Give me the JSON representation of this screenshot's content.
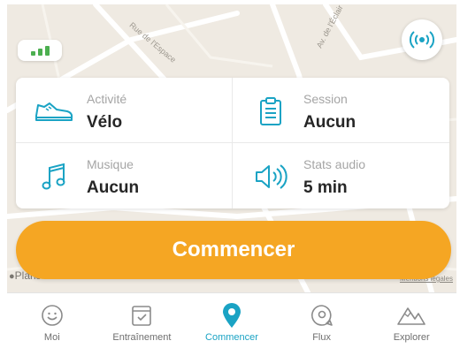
{
  "colors": {
    "accent": "#1aa3c4",
    "start_button": "#f5a623",
    "signal": "#4caf50",
    "map_background": "#efeae2"
  },
  "map": {
    "street_labels": [
      "Rue de l'Espace",
      "Av. de l'Éclair"
    ],
    "attribution": "Plans",
    "legal": "Mentions légales",
    "gps_signal_bars": 3,
    "broadcast_icon": "live-broadcast-icon"
  },
  "settings": {
    "activity": {
      "label": "Activité",
      "value": "Vélo",
      "icon": "shoe-icon"
    },
    "session": {
      "label": "Session",
      "value": "Aucun",
      "icon": "clipboard-icon"
    },
    "music": {
      "label": "Musique",
      "value": "Aucun",
      "icon": "music-note-icon"
    },
    "audio_stats": {
      "label": "Stats audio",
      "value": "5 min",
      "icon": "speaker-icon"
    }
  },
  "start_button": {
    "label": "Commencer"
  },
  "tabbar": {
    "active": "Commencer",
    "items": [
      {
        "label": "Moi",
        "icon": "smiley-icon"
      },
      {
        "label": "Entraînement",
        "icon": "checklist-icon"
      },
      {
        "label": "Commencer",
        "icon": "location-pin-icon"
      },
      {
        "label": "Flux",
        "icon": "chat-bubble-icon"
      },
      {
        "label": "Explorer",
        "icon": "mountains-icon"
      }
    ]
  }
}
